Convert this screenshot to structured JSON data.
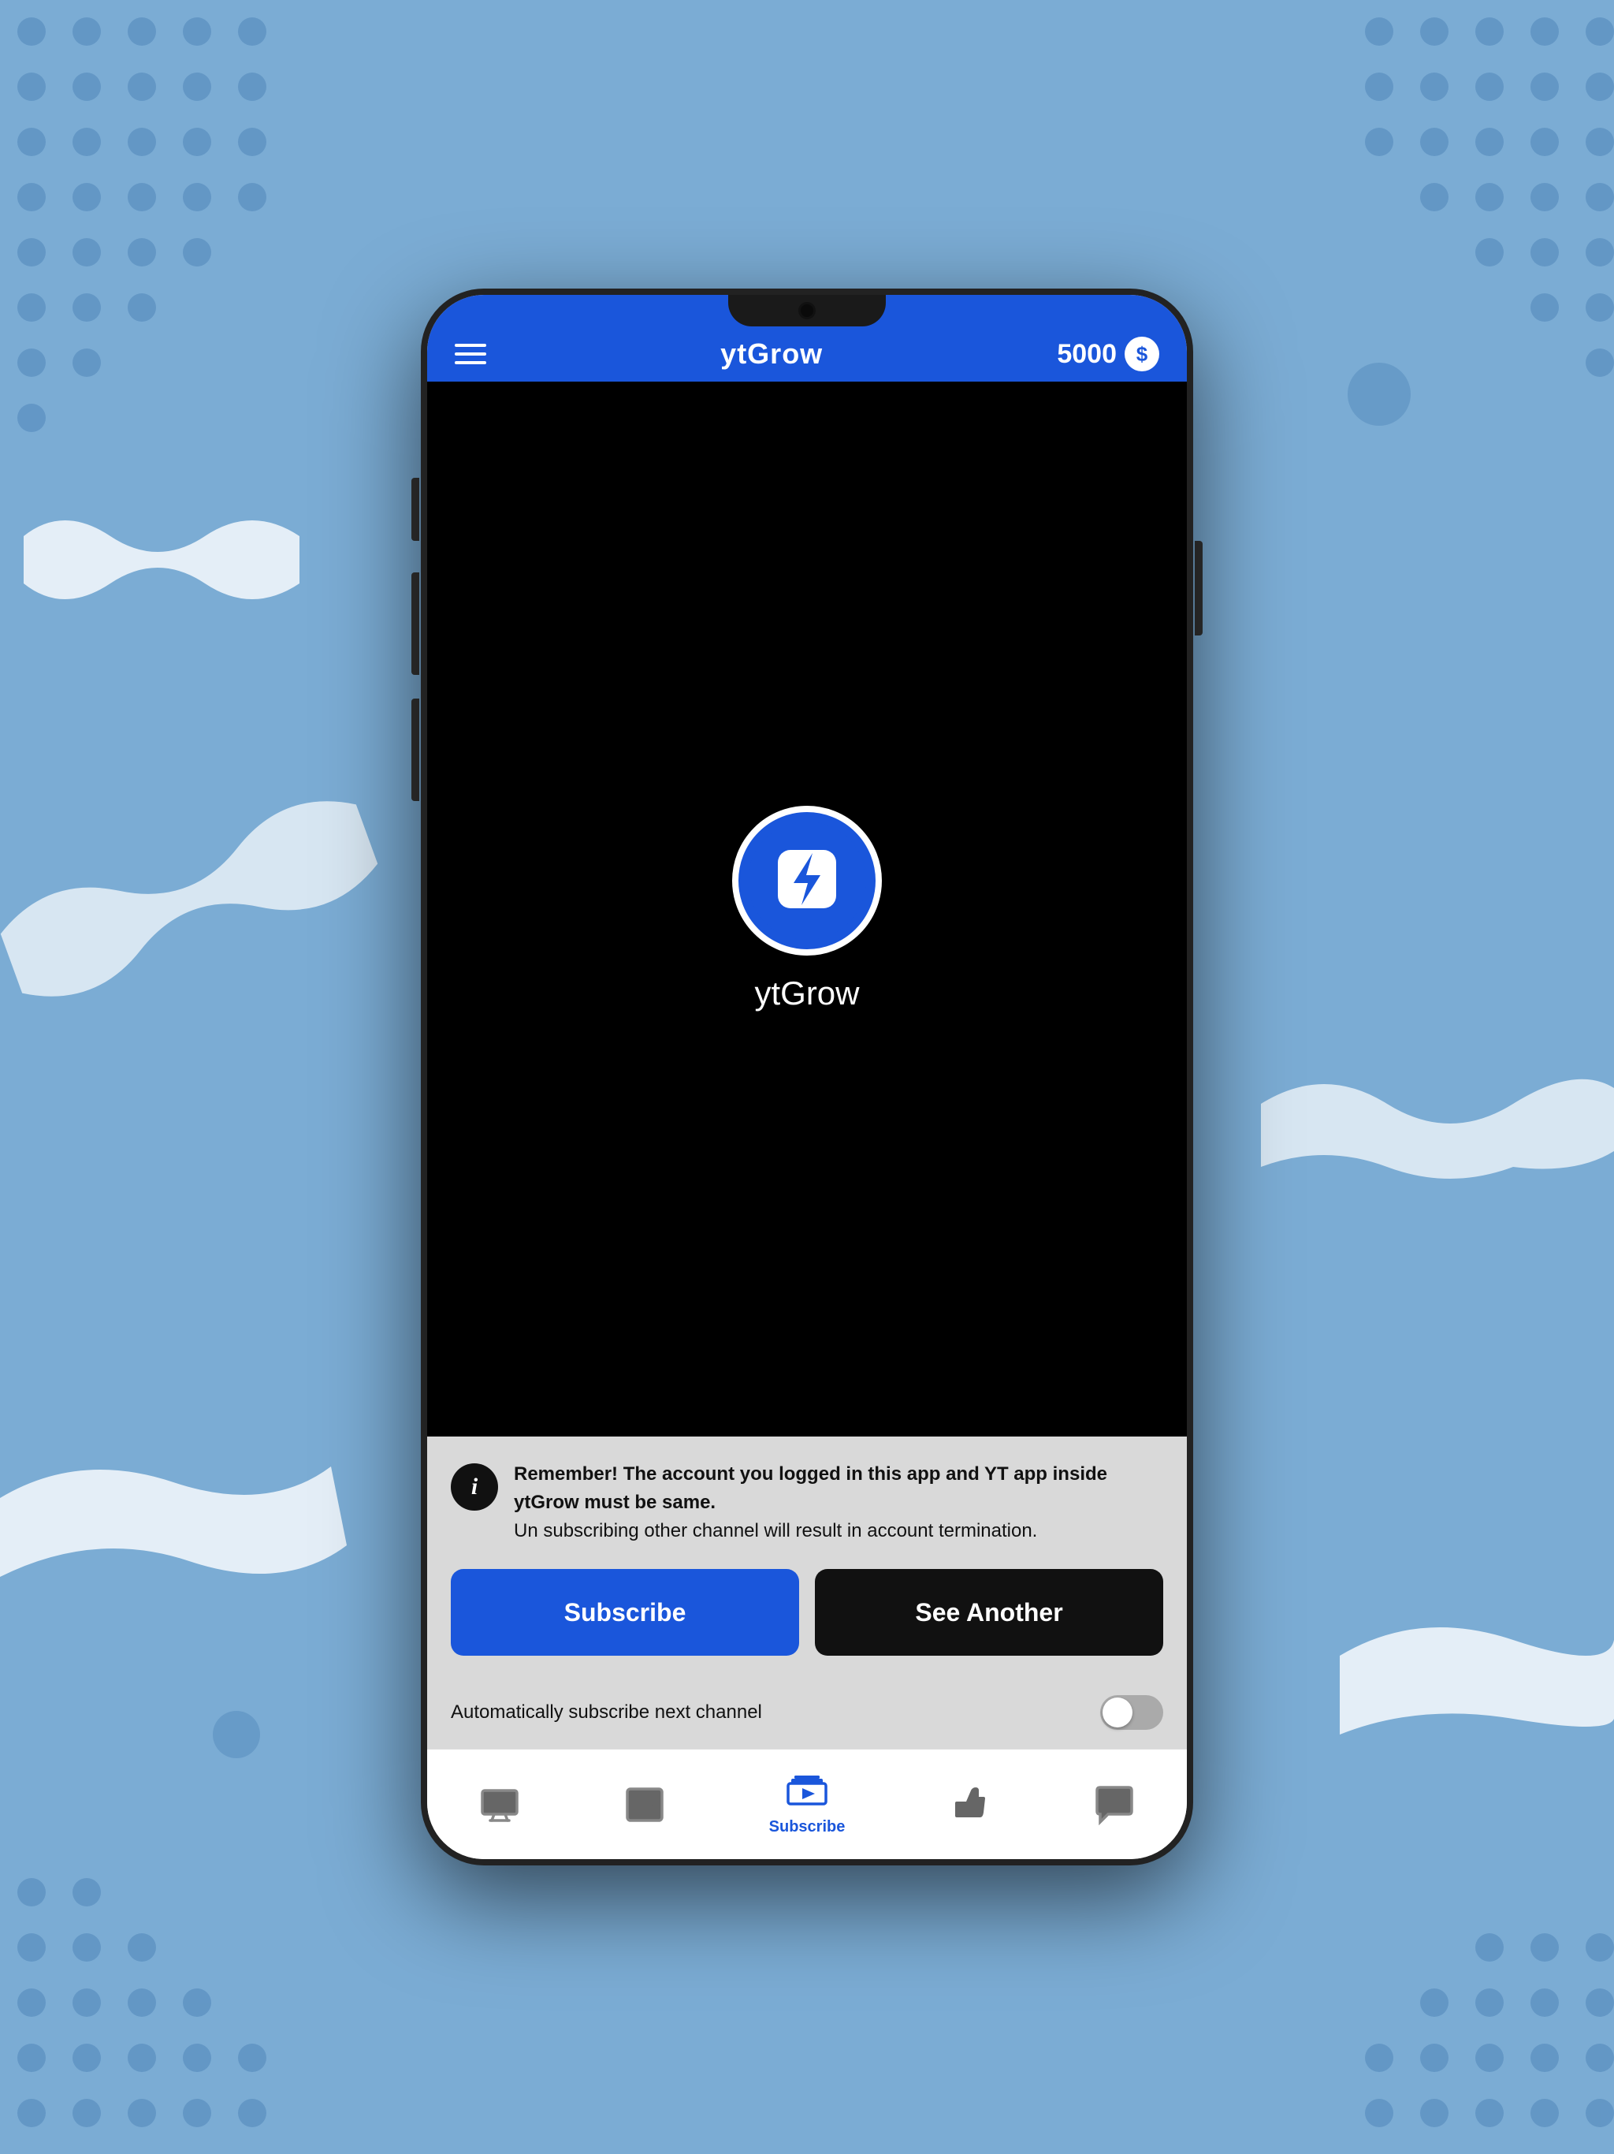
{
  "background": {
    "color": "#7bacd4"
  },
  "app": {
    "title": "ytGrow",
    "coin_amount": "5000",
    "hamburger_aria": "Menu",
    "coin_icon_symbol": "$"
  },
  "channel": {
    "name": "ytGrow"
  },
  "info": {
    "bold_text": "Remember! The account you logged in this app and YT app inside ytGrow must be same.",
    "normal_text": "Un subscribing other channel will result in account termination."
  },
  "buttons": {
    "subscribe": "Subscribe",
    "see_another": "See Another"
  },
  "auto_subscribe": {
    "label": "Automatically subscribe next channel",
    "enabled": false
  },
  "nav": {
    "items": [
      {
        "id": "watch",
        "label": "",
        "active": false
      },
      {
        "id": "videos",
        "label": "",
        "active": false
      },
      {
        "id": "subscribe",
        "label": "Subscribe",
        "active": true
      },
      {
        "id": "like",
        "label": "",
        "active": false
      },
      {
        "id": "comment",
        "label": "",
        "active": false
      }
    ]
  }
}
